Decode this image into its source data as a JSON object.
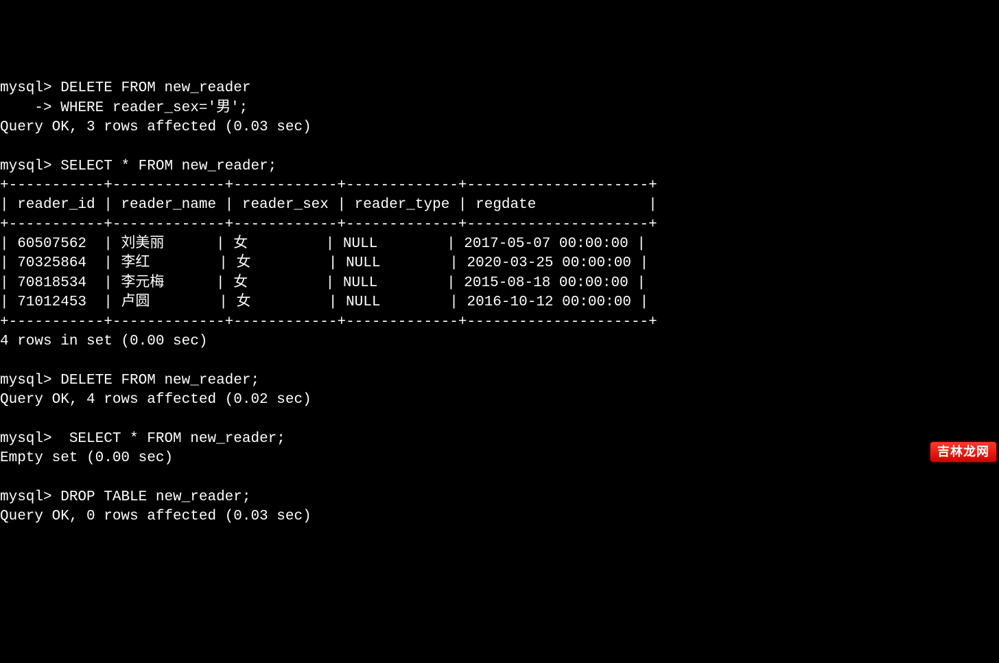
{
  "prompt": "mysql>",
  "cont": "    ->",
  "stmt_delete_where_1": " DELETE FROM new_reader",
  "stmt_delete_where_2": " WHERE reader_sex='男';",
  "result_delete_where": "Query OK, 3 rows affected (0.03 sec)",
  "stmt_select_1": " SELECT * FROM new_reader;",
  "table": {
    "border_top": "+-----------+-------------+------------+-------------+---------------------+",
    "header": "| reader_id | reader_name | reader_sex | reader_type | regdate             |",
    "border_mid": "+-----------+-------------+------------+-------------+---------------------+",
    "rows": [
      "| 60507562  | 刘美丽      | 女         | NULL        | 2017-05-07 00:00:00 |",
      "| 70325864  | 李红        | 女         | NULL        | 2020-03-25 00:00:00 |",
      "| 70818534  | 李元梅      | 女         | NULL        | 2015-08-18 00:00:00 |",
      "| 71012453  | 卢圆        | 女         | NULL        | 2016-10-12 00:00:00 |"
    ],
    "border_bot": "+-----------+-------------+------------+-------------+---------------------+"
  },
  "result_select_1": "4 rows in set (0.00 sec)",
  "stmt_delete_all": " DELETE FROM new_reader;",
  "result_delete_all": "Query OK, 4 rows affected (0.02 sec)",
  "stmt_select_2": "  SELECT * FROM new_reader;",
  "result_select_2": "Empty set (0.00 sec)",
  "stmt_drop": " DROP TABLE new_reader;",
  "result_drop": "Query OK, 0 rows affected (0.03 sec)",
  "watermark": "吉林龙网"
}
